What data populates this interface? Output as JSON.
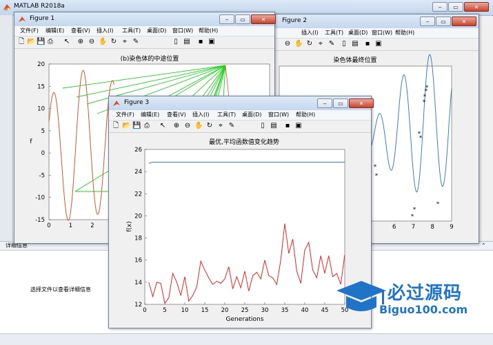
{
  "app": {
    "title": "MATLAB R2018a"
  },
  "details": {
    "label": "详细信息",
    "message": "选择文件以查看详细信息"
  },
  "menu": [
    "文件(F)",
    "编辑(E)",
    "查看(V)",
    "插入(I)",
    "工具(T)",
    "桌面(D)",
    "窗口(W)",
    "帮助(H)"
  ],
  "toolbar_icons": [
    "new-file-icon",
    "open-icon",
    "save-icon",
    "print-icon",
    "pointer-icon",
    "zoom-in-icon",
    "zoom-out-icon",
    "pan-icon",
    "rotate-icon",
    "data-cursor-icon",
    "brush-icon",
    "colorbar-icon",
    "legend-icon",
    "hide-plot-tools-icon",
    "show-plot-tools-icon"
  ],
  "figures": {
    "fig1": {
      "title": "Figure 1",
      "plot_title": "(b)染色体的中途位置",
      "ylabel": "f"
    },
    "fig2": {
      "title": "Figure 2",
      "plot_title": "染色体最终位置"
    },
    "fig3": {
      "title": "Figure 3",
      "plot_title": "最优,平均函数值变化趋势",
      "xlabel": "Generations",
      "ylabel": "f(x)"
    }
  },
  "watermark": {
    "text": "必过源码",
    "url": "Biguo100.com"
  },
  "chart_data": [
    {
      "type": "line",
      "title": "最优,平均函数值变化趋势",
      "xlabel": "Generations",
      "ylabel": "f(x)",
      "xlim": [
        0,
        50
      ],
      "ylim": [
        12,
        26
      ],
      "xticks": [
        0,
        5,
        10,
        15,
        20,
        25,
        30,
        35,
        40,
        45,
        50
      ],
      "yticks": [
        12,
        14,
        16,
        18,
        20,
        22,
        24,
        26
      ],
      "series": [
        {
          "color": "#3a7fc1",
          "x": [
            1,
            2,
            3,
            50
          ],
          "y": [
            24.75,
            24.85,
            24.85,
            24.85
          ]
        },
        {
          "color": "#e8231e",
          "x": [
            1,
            2,
            3,
            4,
            5,
            6,
            7,
            8,
            9,
            10,
            11,
            12,
            13,
            14,
            15,
            16,
            17,
            18,
            19,
            20,
            21,
            22,
            23,
            24,
            25,
            26,
            27,
            28,
            29,
            30,
            31,
            32,
            33,
            34,
            35,
            36,
            37,
            38,
            39,
            40,
            41,
            42,
            43,
            44,
            45,
            46,
            47,
            48,
            49,
            50
          ],
          "y": [
            14.0,
            12.7,
            14.0,
            13.9,
            12.1,
            12.6,
            14.8,
            14.0,
            12.8,
            14.5,
            12.3,
            12.8,
            13.6,
            15.9,
            15.1,
            14.4,
            13.8,
            14.1,
            13.9,
            14.3,
            15.4,
            13.4,
            14.5,
            13.5,
            15.0,
            13.2,
            14.6,
            14.9,
            14.3,
            16.0,
            14.6,
            14.4,
            13.8,
            16.0,
            19.3,
            16.6,
            17.9,
            15.0,
            13.9,
            16.9,
            17.6,
            15.1,
            14.4,
            16.4,
            14.8,
            16.4,
            14.5,
            14.8,
            13.8,
            16.5
          ]
        }
      ]
    },
    {
      "type": "line",
      "title": "(b)染色体的中途位置",
      "ylabel": "f",
      "xlim": [
        0,
        9
      ],
      "ylim": [
        -15,
        20
      ],
      "xticks": [
        0,
        1,
        2
      ],
      "yticks": [
        20,
        15,
        10,
        5,
        0,
        -5,
        -10,
        -15
      ]
    },
    {
      "type": "line",
      "title": "染色体最终位置",
      "xlim": [
        0,
        9
      ],
      "xticks": [
        6,
        7,
        8,
        9
      ]
    }
  ]
}
